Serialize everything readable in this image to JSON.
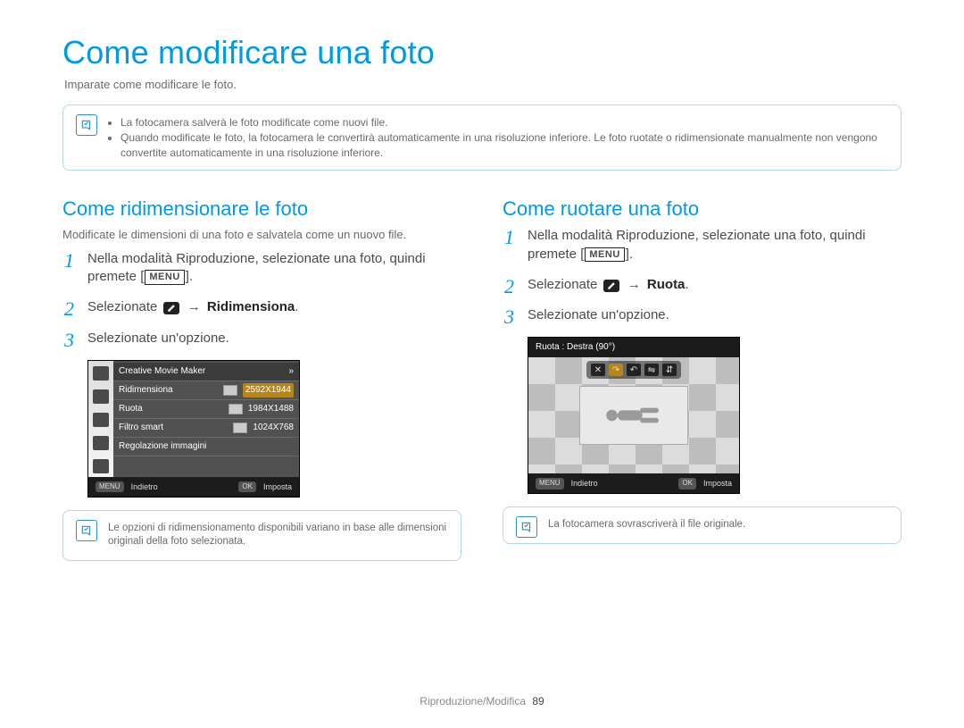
{
  "page_title": "Come modificare una foto",
  "page_intro": "Imparate come modificare le foto.",
  "top_note": {
    "items": [
      "La fotocamera salverà le foto modificate come nuovi file.",
      "Quando modificate le foto, la fotocamera le convertirà automaticamente in una risoluzione inferiore. Le foto ruotate o ridimensionate manualmente non vengono convertite automaticamente in una risoluzione inferiore."
    ]
  },
  "left": {
    "heading": "Come ridimensionare le foto",
    "desc": "Modificate le dimensioni di una foto e salvatela come un nuovo file.",
    "steps": {
      "s1_a": "Nella modalità Riproduzione, selezionate una foto, quindi premete [",
      "s1_b": "].",
      "menu_key": "MENU",
      "s2_a": "Selezionate ",
      "s2_arrow": " → ",
      "s2_opt": "Ridimensiona",
      "s2_b": ".",
      "s3": "Selezionate un'opzione."
    },
    "ui": {
      "menu_title": "Creative Movie Maker",
      "rows": [
        {
          "label": "Ridimensiona",
          "value": "2592X1944",
          "sel": true
        },
        {
          "label": "Ruota",
          "value": "1984X1488",
          "sel": false
        },
        {
          "label": "Filtro smart",
          "value": "1024X768",
          "sel": false
        },
        {
          "label": "Regolazione immagini",
          "value": "",
          "sel": false
        }
      ],
      "back_key": "MENU",
      "back": "Indietro",
      "ok_key": "OK",
      "ok": "Imposta"
    },
    "note": "Le opzioni di ridimensionamento disponibili variano in base alle dimensioni originali della foto selezionata."
  },
  "right": {
    "heading": "Come ruotare una foto",
    "steps": {
      "s1_a": "Nella modalità Riproduzione, selezionate una foto, quindi premete [",
      "s1_b": "].",
      "menu_key": "MENU",
      "s2_a": "Selezionate ",
      "s2_arrow": " → ",
      "s2_opt": "Ruota",
      "s2_b": ".",
      "s3": "Selezionate un'opzione."
    },
    "ui": {
      "title": "Ruota : Destra (90°)",
      "back_key": "MENU",
      "back": "Indietro",
      "ok_key": "OK",
      "ok": "Imposta"
    },
    "note": "La fotocamera sovrascriverà il file originale."
  },
  "footer": {
    "section": "Riproduzione/Modifica",
    "page": "89"
  }
}
